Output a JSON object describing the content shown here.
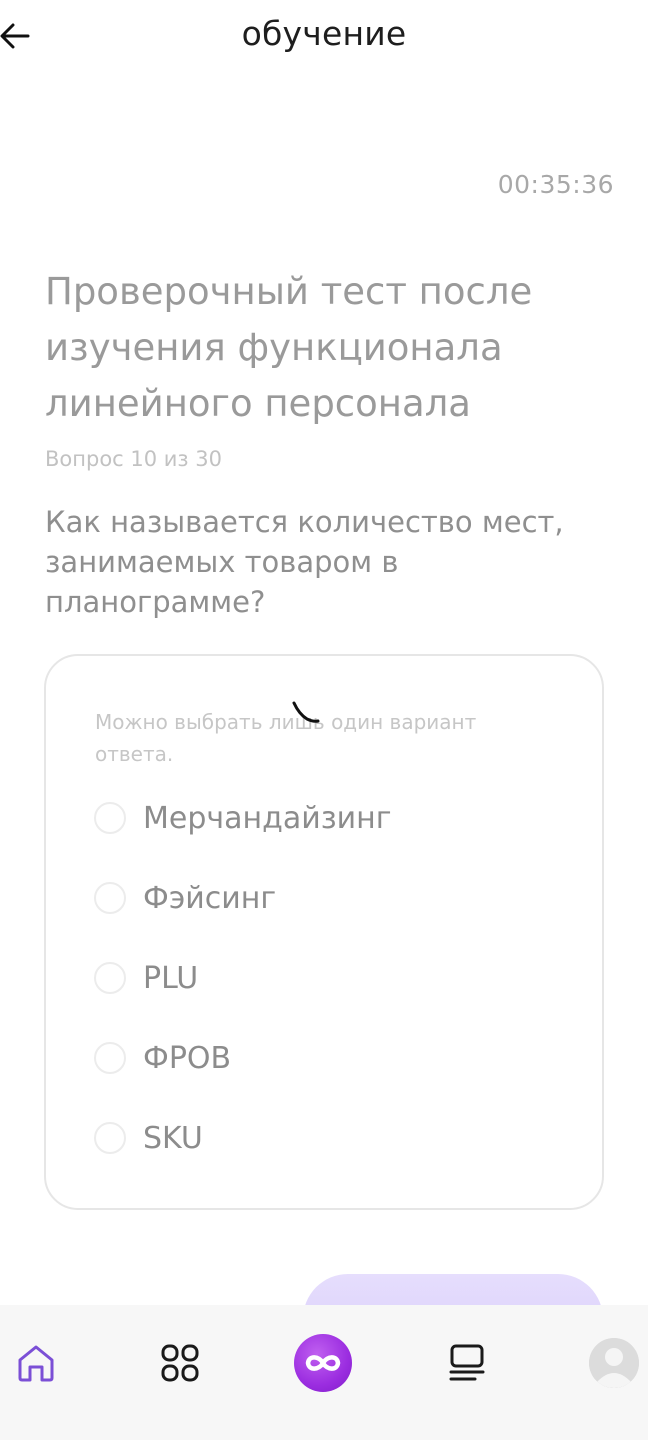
{
  "header": {
    "title": "обучение"
  },
  "timer": "00:35:36",
  "test": {
    "title": "Проверочный тест после изучения функционала линейного персонала",
    "counter": "Вопрос 10 из 30",
    "question": "Как называется количество мест, занимаемых товаром в планограмме?"
  },
  "answers": {
    "hint": "Можно выбрать лишь один вариант ответа.",
    "options": [
      {
        "label": "Мерчандайзинг"
      },
      {
        "label": "Фэйсинг"
      },
      {
        "label": "PLU"
      },
      {
        "label": "ФРОВ"
      },
      {
        "label": "SKU"
      }
    ]
  },
  "nav": {
    "items": [
      {
        "icon": "home-icon"
      },
      {
        "icon": "apps-grid-icon"
      },
      {
        "icon": "infinity-icon"
      },
      {
        "icon": "feed-icon"
      },
      {
        "icon": "profile-avatar"
      }
    ]
  },
  "colors": {
    "accent": "#7b4fd6",
    "center_button": "#9b2de0",
    "submit_button": "#d8ccfb"
  }
}
